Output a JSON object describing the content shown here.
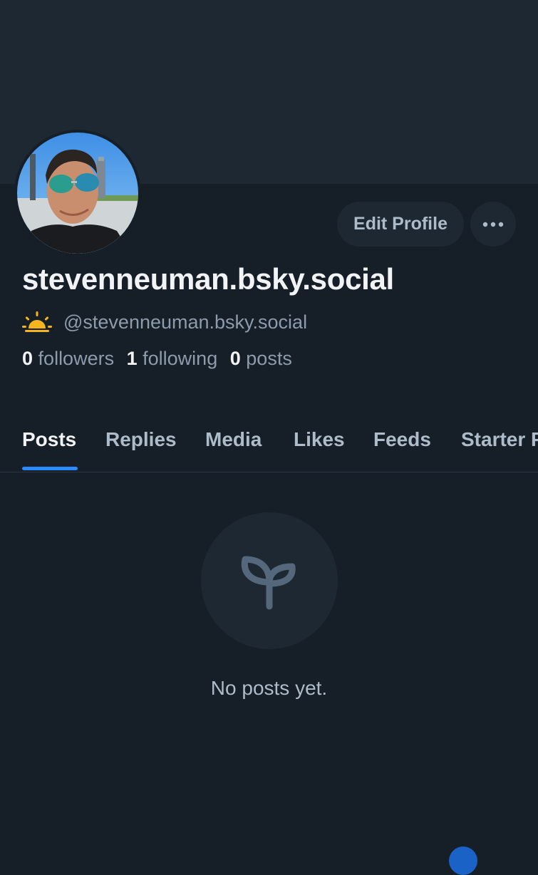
{
  "profile": {
    "display_name": "stevenneuman.bsky.social",
    "handle": "@stevenneuman.bsky.social",
    "avatar_icon": "avatar-photo",
    "status_icon": "sunrise-icon"
  },
  "actions": {
    "edit_label": "Edit Profile",
    "more_icon": "ellipsis-icon"
  },
  "stats": {
    "followers_count": "0",
    "followers_label": "followers",
    "following_count": "1",
    "following_label": "following",
    "posts_count": "0",
    "posts_label": "posts"
  },
  "tabs": [
    {
      "label": "Posts",
      "active": true
    },
    {
      "label": "Replies",
      "active": false
    },
    {
      "label": "Media",
      "active": false
    },
    {
      "label": "Likes",
      "active": false
    },
    {
      "label": "Feeds",
      "active": false
    },
    {
      "label": "Starter Packs",
      "active": false
    }
  ],
  "empty_state": {
    "icon": "seedling-icon",
    "text": "No posts yet."
  },
  "colors": {
    "background": "#161e27",
    "banner": "#1e2833",
    "accent": "#2b8aff",
    "primary_text": "#f1f3f5",
    "secondary_text": "#8d9bab"
  }
}
